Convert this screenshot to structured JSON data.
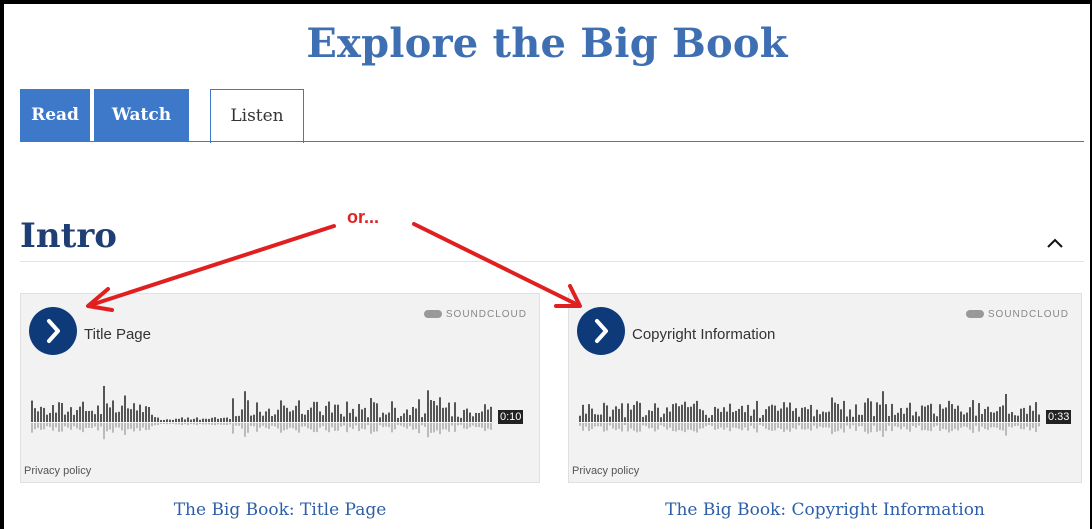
{
  "page": {
    "title": "Explore the Big Book"
  },
  "tabs": [
    {
      "label": "Read",
      "active": false
    },
    {
      "label": "Watch",
      "active": false
    },
    {
      "label": "Listen",
      "active": true
    }
  ],
  "section": {
    "title": "Intro"
  },
  "annotation": {
    "text": "or..."
  },
  "players": [
    {
      "track_title": "Title Page",
      "brand": "SOUNDCLOUD",
      "duration": "0:10",
      "privacy": "Privacy policy",
      "caption": "The Big Book: Title Page"
    },
    {
      "track_title": "Copyright Information",
      "brand": "SOUNDCLOUD",
      "duration": "0:33",
      "privacy": "Privacy policy",
      "caption": "The Big Book: Copyright Information"
    }
  ],
  "colors": {
    "brand_blue": "#3e78c8",
    "title_blue": "#3e6fb3",
    "section_navy": "#1f3e73",
    "play_navy": "#0f3a7a",
    "annotation_red": "#e02020"
  }
}
